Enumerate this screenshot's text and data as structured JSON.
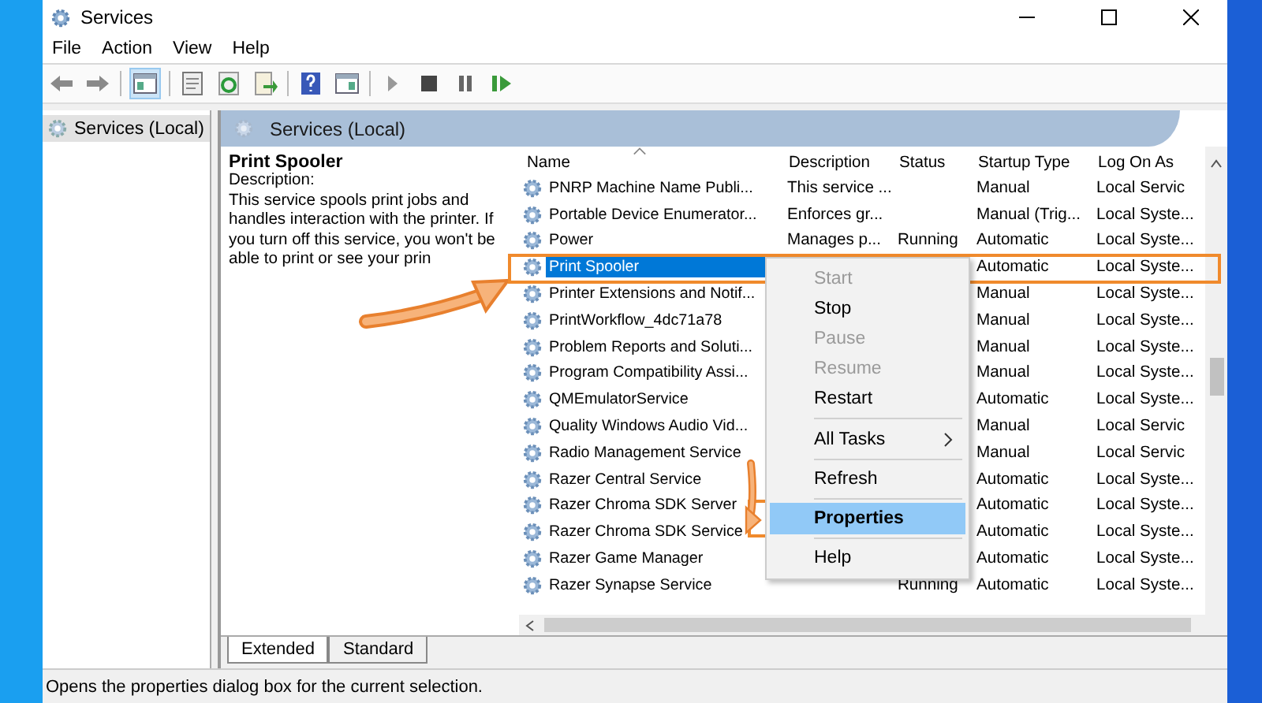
{
  "window": {
    "title": "Services"
  },
  "menu": [
    "File",
    "Action",
    "View",
    "Help"
  ],
  "tree": {
    "items": [
      {
        "label": "Services (Local)",
        "selected": true
      }
    ]
  },
  "panel": {
    "title": "Services (Local)"
  },
  "details": {
    "title": "Print Spooler",
    "description_label": "Description:",
    "description": "This service spools print jobs and handles interaction with the printer. If you turn off this service, you won't be able to print or see your prin"
  },
  "table": {
    "columns": [
      "Name",
      "Description",
      "Status",
      "Startup Type",
      "Log On As"
    ],
    "rows": [
      {
        "selected": false,
        "cells": [
          "PNRP Machine Name Publi...",
          "This service ...",
          "",
          "Manual",
          "Local Servic"
        ]
      },
      {
        "selected": false,
        "cells": [
          "Portable Device Enumerator...",
          "Enforces gr...",
          "",
          "Manual (Trig...",
          "Local Syste..."
        ]
      },
      {
        "selected": false,
        "cells": [
          "Power",
          "Manages p...",
          "Running",
          "Automatic",
          "Local Syste..."
        ]
      },
      {
        "selected": true,
        "cells": [
          "Print Spooler",
          "",
          "",
          "Automatic",
          "Local Syste..."
        ]
      },
      {
        "selected": false,
        "cells": [
          "Printer Extensions and Notif...",
          "",
          "",
          "Manual",
          "Local Syste..."
        ]
      },
      {
        "selected": false,
        "cells": [
          "PrintWorkflow_4dc71a78",
          "",
          "",
          "Manual",
          "Local Syste..."
        ]
      },
      {
        "selected": false,
        "cells": [
          "Problem Reports and Soluti...",
          "",
          "",
          "Manual",
          "Local Syste..."
        ]
      },
      {
        "selected": false,
        "cells": [
          "Program Compatibility Assi...",
          "",
          "",
          "Manual",
          "Local Syste..."
        ]
      },
      {
        "selected": false,
        "cells": [
          "QMEmulatorService",
          "",
          "",
          "Automatic",
          "Local Syste..."
        ]
      },
      {
        "selected": false,
        "cells": [
          "Quality Windows Audio Vid...",
          "",
          "",
          "Manual",
          "Local Servic"
        ]
      },
      {
        "selected": false,
        "cells": [
          "Radio Management Service",
          "",
          "",
          "Manual",
          "Local Servic"
        ]
      },
      {
        "selected": false,
        "cells": [
          "Razer Central Service",
          "",
          "",
          "Automatic",
          "Local Syste..."
        ]
      },
      {
        "selected": false,
        "cells": [
          "Razer Chroma SDK Server",
          "",
          "",
          "Automatic",
          "Local Syste..."
        ]
      },
      {
        "selected": false,
        "cells": [
          "Razer Chroma SDK Service",
          "",
          "",
          "Automatic",
          "Local Syste..."
        ]
      },
      {
        "selected": false,
        "cells": [
          "Razer Game Manager",
          "",
          "",
          "Automatic",
          "Local Syste..."
        ]
      },
      {
        "selected": false,
        "cells": [
          "Razer Synapse Service",
          "",
          "Running",
          "Automatic",
          "Local Syste..."
        ]
      }
    ]
  },
  "context_menu": {
    "items": [
      {
        "kind": "item",
        "label": "Start",
        "disabled": true,
        "selected": false
      },
      {
        "kind": "item",
        "label": "Stop",
        "disabled": false,
        "selected": false
      },
      {
        "kind": "item",
        "label": "Pause",
        "disabled": true,
        "selected": false
      },
      {
        "kind": "item",
        "label": "Resume",
        "disabled": true,
        "selected": false
      },
      {
        "kind": "item",
        "label": "Restart",
        "disabled": false,
        "selected": false
      },
      {
        "kind": "separator"
      },
      {
        "kind": "submenu",
        "label": "All Tasks",
        "disabled": false,
        "selected": false
      },
      {
        "kind": "separator"
      },
      {
        "kind": "item",
        "label": "Refresh",
        "disabled": false,
        "selected": false
      },
      {
        "kind": "separator"
      },
      {
        "kind": "item",
        "label": "Properties",
        "disabled": false,
        "selected": true
      },
      {
        "kind": "separator"
      },
      {
        "kind": "item",
        "label": "Help",
        "disabled": false,
        "selected": false
      }
    ]
  },
  "view_tabs": [
    {
      "label": "Extended",
      "selected": true
    },
    {
      "label": "Standard",
      "selected": false
    }
  ],
  "status_bar": "Opens the properties dialog box for the current selection."
}
